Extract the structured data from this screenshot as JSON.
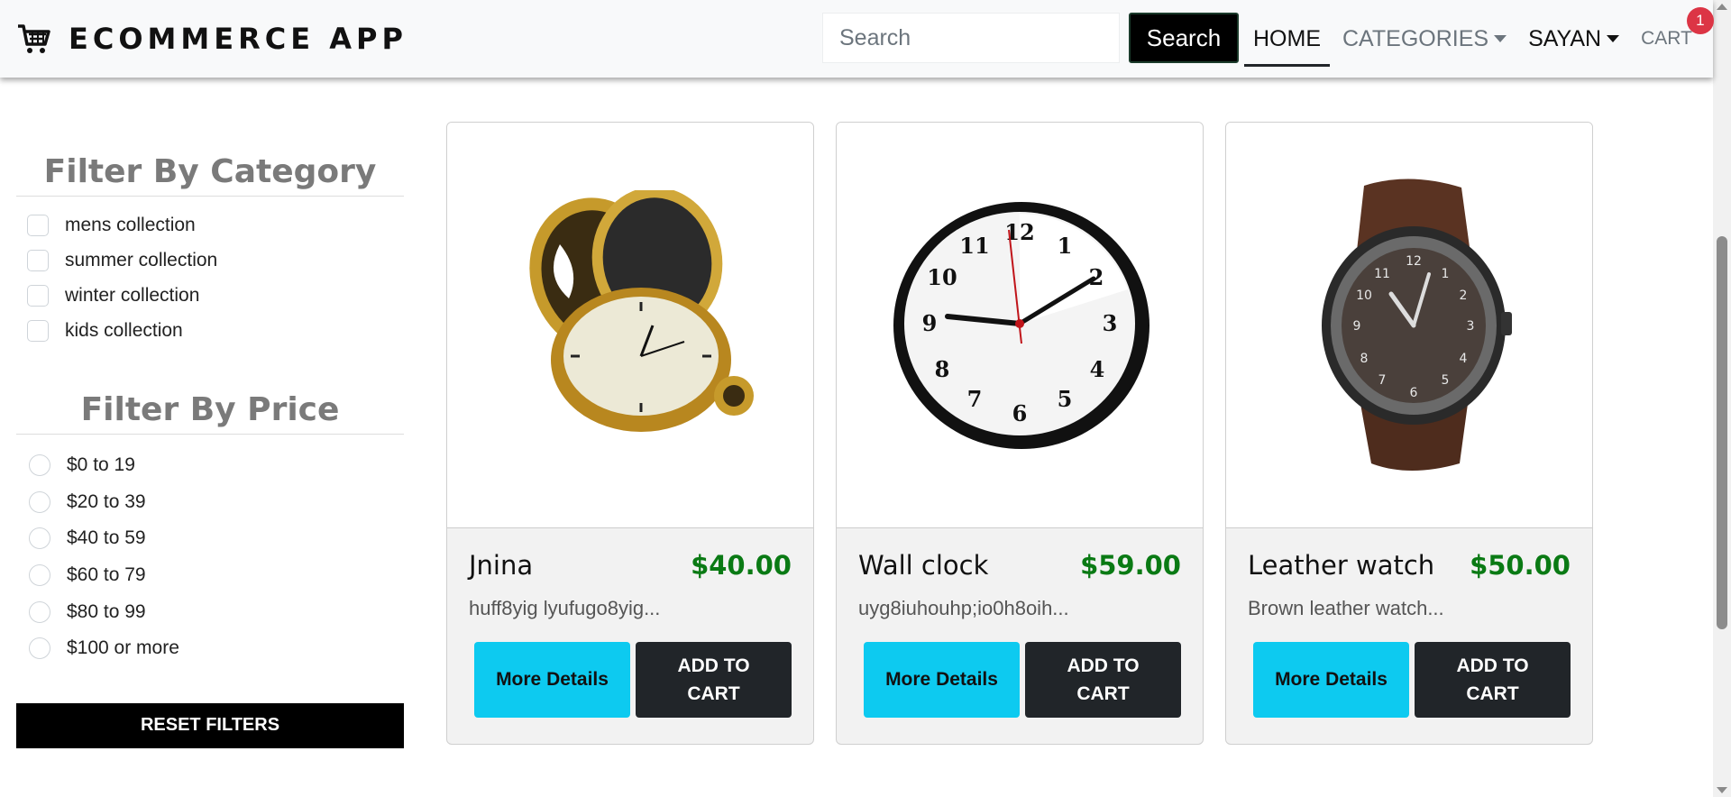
{
  "brand": {
    "name": "ECOMMERCE APP",
    "icon": "cart-icon"
  },
  "search": {
    "placeholder": "Search",
    "value": "",
    "button_label": "Search"
  },
  "nav": {
    "home": "HOME",
    "categories": "CATEGORIES",
    "user": "SAYAN",
    "cart": "CART",
    "cart_count": "1"
  },
  "sidebar": {
    "category_title": "Filter By Category",
    "categories": [
      {
        "label": "mens collection",
        "checked": false
      },
      {
        "label": "summer collection",
        "checked": false
      },
      {
        "label": "winter collection",
        "checked": false
      },
      {
        "label": "kids collection",
        "checked": false
      }
    ],
    "price_title": "Filter By Price",
    "prices": [
      {
        "label": "$0 to 19",
        "selected": false
      },
      {
        "label": "$20 to 39",
        "selected": false
      },
      {
        "label": "$40 to 59",
        "selected": false
      },
      {
        "label": "$60 to 79",
        "selected": false
      },
      {
        "label": "$80 to 99",
        "selected": false
      },
      {
        "label": "$100 or more",
        "selected": false
      }
    ],
    "reset_label": "RESET FILTERS"
  },
  "products": [
    {
      "name": "Jnina",
      "price": "$40.00",
      "description": "huff8yig lyufugo8yig...",
      "image": "pocket-watch-image",
      "details_label": "More Details",
      "cart_label": "ADD TO CART"
    },
    {
      "name": "Wall clock",
      "price": "$59.00",
      "description": "uyg8iuhouhp;io0h8oih...",
      "image": "wall-clock-image",
      "details_label": "More Details",
      "cart_label": "ADD TO CART"
    },
    {
      "name": "Leather watch",
      "price": "$50.00",
      "description": "Brown leather watch...",
      "image": "leather-watch-image",
      "details_label": "More Details",
      "cart_label": "ADD TO CART"
    }
  ],
  "colors": {
    "accent": "#0dcaf0",
    "price": "#0a7a14",
    "badge": "#dc3545",
    "dark": "#212529"
  }
}
